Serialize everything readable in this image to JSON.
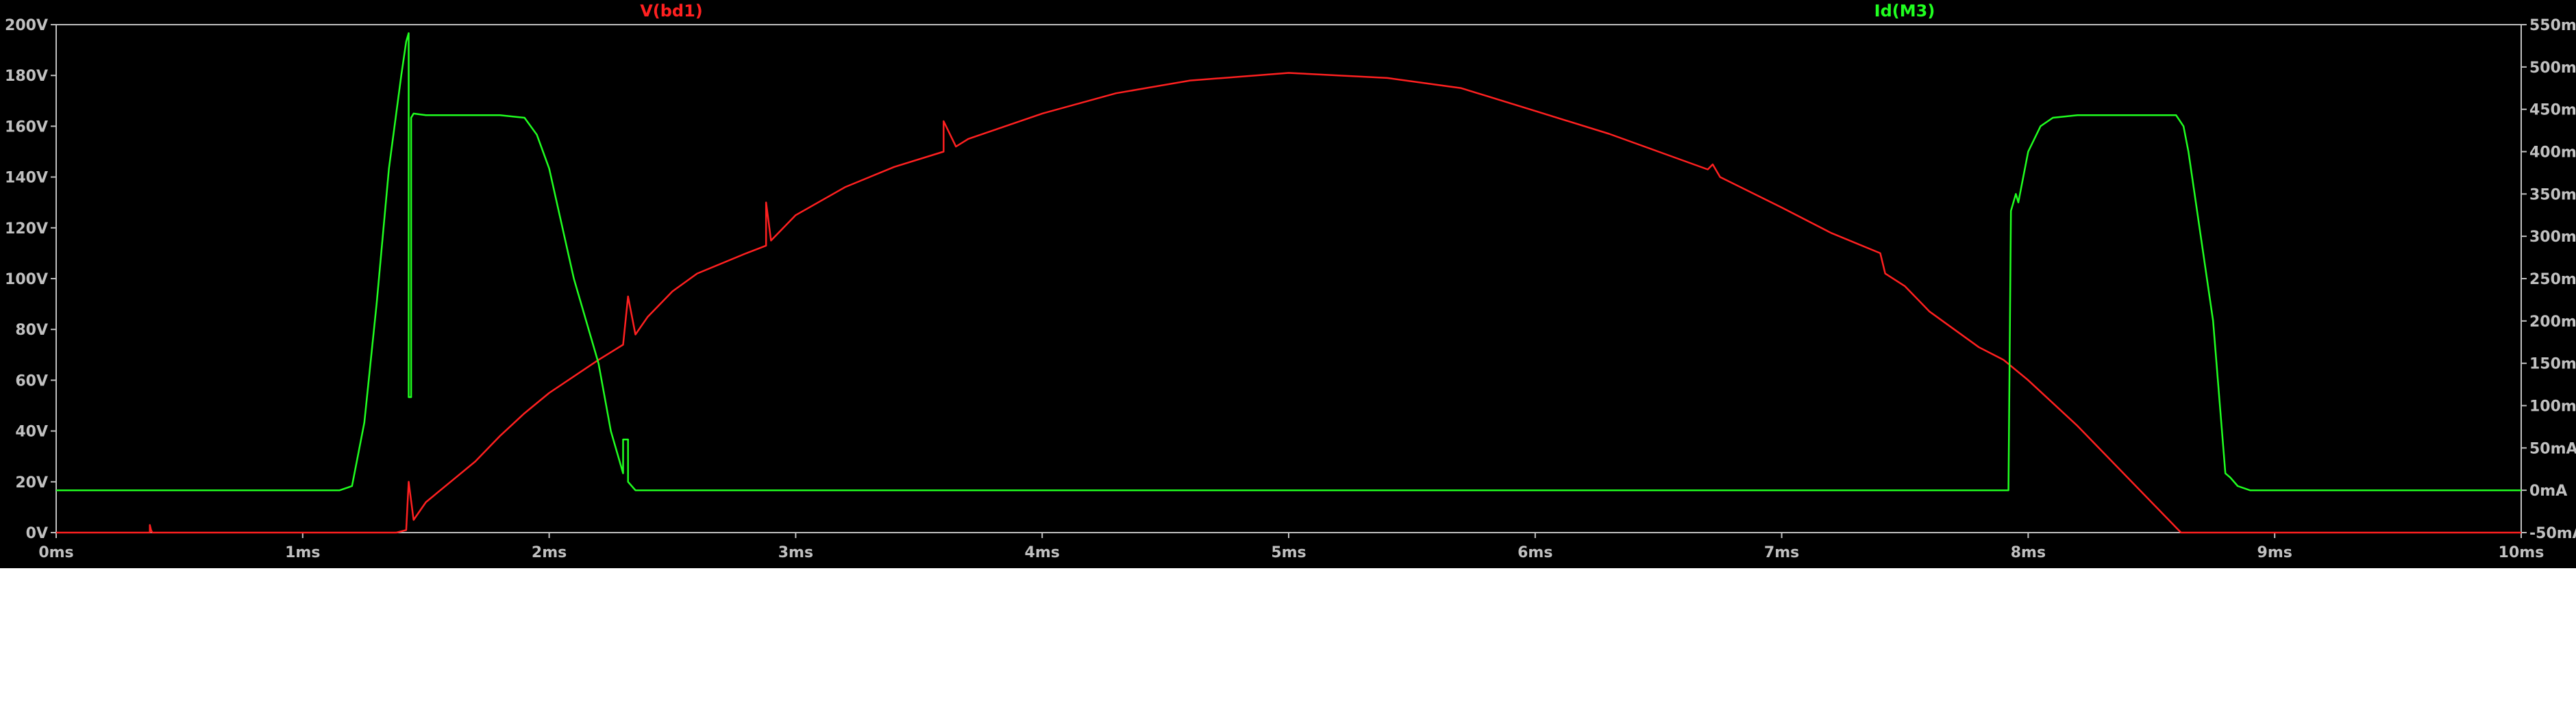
{
  "chart_data": {
    "type": "line",
    "grid": false,
    "background": "#000000",
    "axis_color": "#c0c0c0",
    "x_ticks": [
      "0ms",
      "1ms",
      "2ms",
      "3ms",
      "4ms",
      "5ms",
      "6ms",
      "7ms",
      "8ms",
      "9ms",
      "10ms"
    ],
    "xlim": [
      0,
      10
    ],
    "left_ticks": [
      "0V",
      "20V",
      "40V",
      "60V",
      "80V",
      "100V",
      "120V",
      "140V",
      "160V",
      "180V",
      "200V"
    ],
    "ylim_left": [
      0,
      200
    ],
    "right_ticks": [
      "-50mA",
      "0mA",
      "50mA",
      "100mA",
      "150mA",
      "200mA",
      "250mA",
      "300mA",
      "350mA",
      "400mA",
      "450mA",
      "500mA",
      "550mA"
    ],
    "ylim_right": [
      -50,
      550
    ],
    "series": [
      {
        "name": "V(bd1)",
        "axis": "left",
        "color": "#ff2020",
        "x": [
          0,
          0.38,
          0.38,
          0.385,
          0.39,
          1.28,
          1.38,
          1.42,
          1.43,
          1.45,
          1.5,
          1.6,
          1.7,
          1.8,
          1.9,
          2.0,
          2.2,
          2.3,
          2.32,
          2.35,
          2.4,
          2.5,
          2.6,
          2.8,
          2.88,
          2.88,
          2.9,
          3.0,
          3.2,
          3.4,
          3.6,
          3.6,
          3.65,
          3.7,
          4.0,
          4.3,
          4.6,
          5.0,
          5.4,
          5.7,
          6.0,
          6.3,
          6.5,
          6.7,
          6.72,
          6.75,
          7.0,
          7.2,
          7.4,
          7.42,
          7.5,
          7.6,
          7.8,
          7.9,
          8.0,
          8.2,
          8.4,
          8.6,
          8.62,
          8.7,
          10
        ],
        "y": [
          0,
          0,
          3,
          1,
          0,
          0,
          0,
          1,
          20,
          5,
          12,
          20,
          28,
          38,
          47,
          55,
          68,
          74,
          93,
          78,
          85,
          95,
          102,
          110,
          113,
          130,
          115,
          125,
          136,
          144,
          150,
          162,
          152,
          155,
          165,
          173,
          178,
          181,
          179,
          175,
          166,
          157,
          150,
          143,
          145,
          140,
          128,
          118,
          110,
          102,
          97,
          87,
          73,
          68,
          60,
          42,
          22,
          2,
          0,
          0,
          0
        ]
      },
      {
        "name": "Id(M3)",
        "axis": "right",
        "color": "#20ff20",
        "x": [
          0,
          1.15,
          1.2,
          1.25,
          1.3,
          1.35,
          1.4,
          1.42,
          1.43,
          1.43,
          1.44,
          1.44,
          1.45,
          1.5,
          1.8,
          1.9,
          1.95,
          2.0,
          2.1,
          2.2,
          2.25,
          2.3,
          2.3,
          2.32,
          2.32,
          2.35,
          2.4,
          7.92,
          7.93,
          7.95,
          7.96,
          8.0,
          8.05,
          8.1,
          8.2,
          8.6,
          8.63,
          8.65,
          8.75,
          8.8,
          8.82,
          8.85,
          8.9,
          10
        ],
        "y": [
          0,
          0,
          5,
          80,
          220,
          380,
          490,
          530,
          540,
          110,
          110,
          440,
          445,
          443,
          443,
          440,
          420,
          380,
          250,
          150,
          70,
          20,
          60,
          60,
          10,
          0,
          0,
          0,
          330,
          350,
          340,
          400,
          430,
          440,
          443,
          443,
          430,
          400,
          200,
          20,
          15,
          5,
          0,
          0
        ]
      }
    ]
  }
}
